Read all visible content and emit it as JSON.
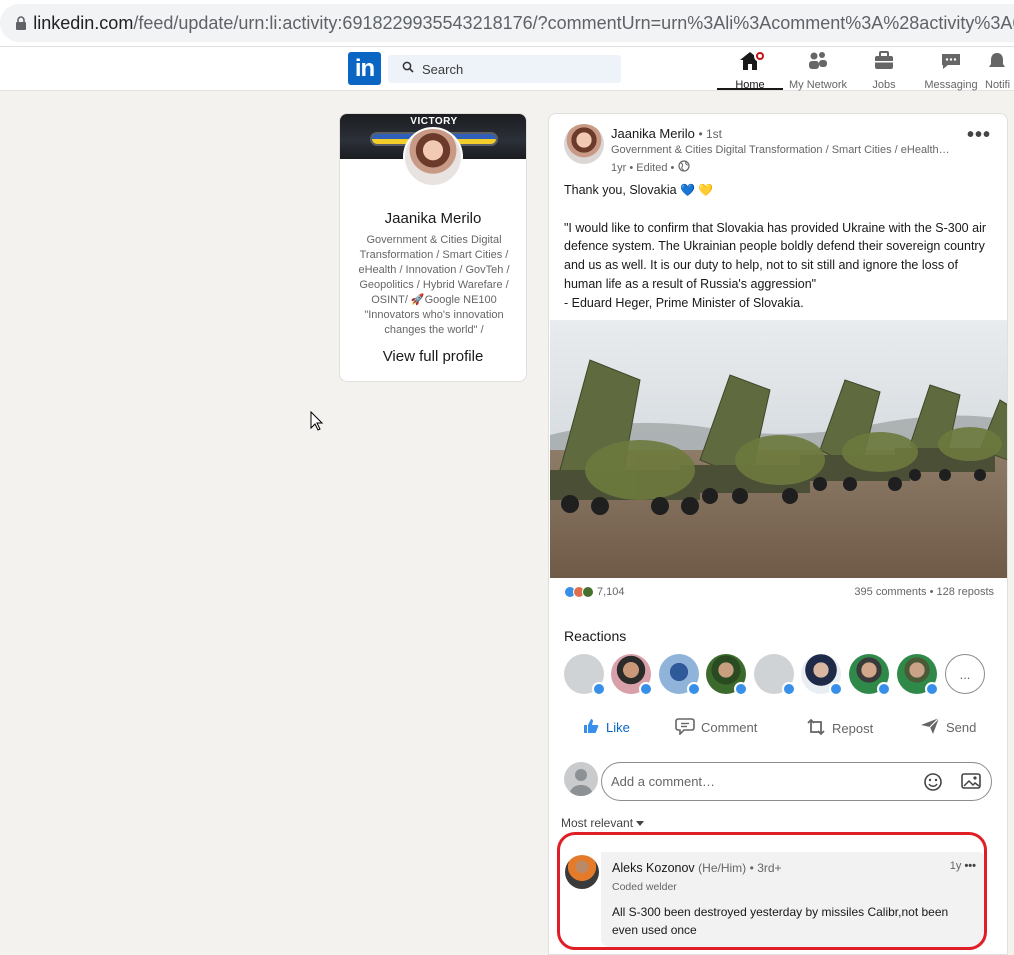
{
  "browser": {
    "url_host": "linkedin.com",
    "url_path": "/feed/update/urn:li:activity:6918229935543218176/?commentUrn=urn%3Ali%3Acomment%3A%28activity%3A691"
  },
  "nav": {
    "logo_text": "in",
    "search_placeholder": "Search",
    "items": [
      {
        "label": "Home",
        "icon": "home-icon",
        "active": true
      },
      {
        "label": "My Network",
        "icon": "network-icon"
      },
      {
        "label": "Jobs",
        "icon": "briefcase-icon"
      },
      {
        "label": "Messaging",
        "icon": "messaging-icon"
      },
      {
        "label": "Notifi",
        "icon": "bell-icon"
      }
    ]
  },
  "profile_card": {
    "banner_text": "VICTORY",
    "name": "Jaanika Merilo",
    "headline": "Government & Cities Digital Transformation / Smart Cities / eHealth / Innovation / GovTeh / Geopolitics / Hybrid Warefare / OSINT/ 🚀Google NE100 \"Innovators who's innovation changes the world\" /",
    "view_label": "View full profile"
  },
  "post": {
    "author_name": "Jaanika Merilo",
    "degree": "• 1st",
    "headline": "Government & Cities Digital Transformation / Smart Cities / eHealth…",
    "time": "1yr • Edited •",
    "line1": "Thank you, Slovakia ",
    "hearts": "💙 💛",
    "body": "\"I would like to confirm that Slovakia has provided Ukraine with the S-300 air defence system. The Ukrainian people boldly defend their sovereign country and us as well. It is our duty to help, not to sit still and ignore the loss of human life as a result of Russia's aggression\"\n- Eduard Heger, Prime Minister of Slovakia.",
    "reaction_count": "7,104",
    "comments_reposts": "395 comments • 128 reposts",
    "reactions_title": "Reactions",
    "more_reactors": "...",
    "actions": {
      "like": "Like",
      "comment": "Comment",
      "repost": "Repost",
      "send": "Send"
    },
    "comment_placeholder": "Add a comment…",
    "sort_label": "Most relevant"
  },
  "comment": {
    "name": "Aleks Kozonov",
    "pronouns": "(He/Him)",
    "degree": "• 3rd+",
    "time": "1y",
    "headline": "Coded welder",
    "text": "All S-300 been destroyed yesterday by missiles Calibr,not been even used once"
  },
  "colors": {
    "brand": "#0a66c2",
    "highlight": "#e01e26",
    "background": "#f4f2ee"
  }
}
